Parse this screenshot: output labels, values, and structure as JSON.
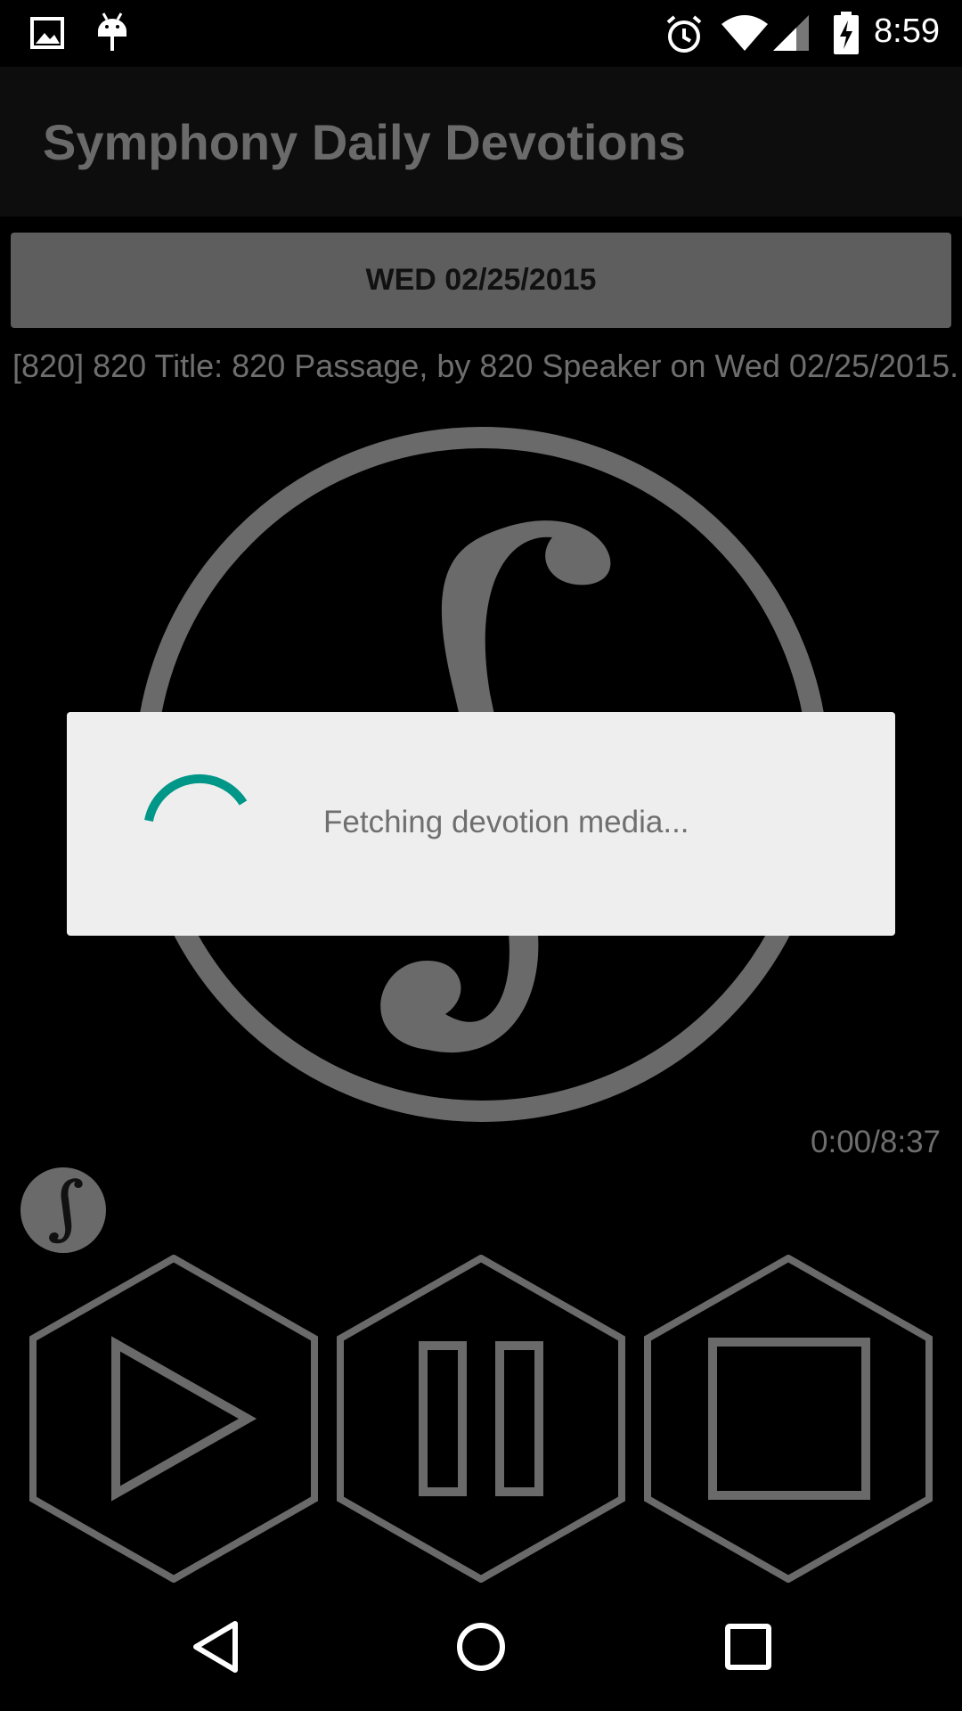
{
  "status_bar": {
    "time": "8:59",
    "left_icons": [
      "image-icon",
      "android-debug-icon"
    ],
    "right_icons": [
      "alarm-icon",
      "wifi-icon",
      "signal-icon",
      "battery-charging-icon"
    ]
  },
  "app_bar": {
    "title": "Symphony Daily Devotions"
  },
  "date_button": {
    "label": "WED 02/25/2015"
  },
  "devotion": {
    "info": "[820] 820 Title: 820 Passage, by 820 Speaker on Wed 02/25/2015."
  },
  "player": {
    "time": "0:00/8:37",
    "controls": [
      "play-icon",
      "pause-icon",
      "stop-icon"
    ]
  },
  "dialog": {
    "message": "Fetching devotion media..."
  },
  "nav_bar": {
    "buttons": [
      "back-icon",
      "home-icon",
      "recents-icon"
    ]
  },
  "colors": {
    "accent": "#009688",
    "logo_gray": "#6a6a6a",
    "dialog_bg": "#eeeeee"
  }
}
